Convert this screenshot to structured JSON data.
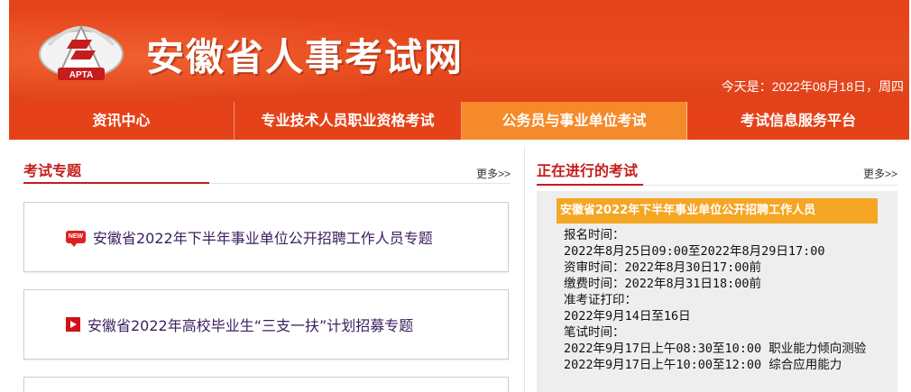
{
  "header": {
    "site_title": "安徽省人事考试网",
    "logo_text": "APTA",
    "date_text": "今天是：2022年08月18日，周四"
  },
  "nav": {
    "items": [
      {
        "label": "资讯中心",
        "active": false
      },
      {
        "label": "专业技术人员职业资格考试",
        "active": false
      },
      {
        "label": "公务员与事业单位考试",
        "active": true
      },
      {
        "label": "考试信息服务平台",
        "active": false
      }
    ]
  },
  "left": {
    "title": "考试专题",
    "more": "更多>>",
    "topics": [
      {
        "label": "安徽省2022年下半年事业单位公开招聘工作人员专题",
        "icon": "new-badge-icon",
        "icon_text": "NEW"
      },
      {
        "label": "安徽省2022年高校毕业生“三支一扶”计划招募专题",
        "icon": "play-icon"
      }
    ]
  },
  "right": {
    "title": "正在进行的考试",
    "more": "更多>>",
    "exam": {
      "title": "安徽省2022年下半年事业单位公开招聘工作人员",
      "lines": [
        "报名时间：",
        "2022年8月25日09:00至2022年8月29日17:00",
        "资审时间：2022年8月30日17:00前",
        "缴费时间：2022年8月31日18:00前",
        "准考证打印：",
        "2022年9月14日至16日",
        "笔试时间：",
        "2022年9月17日上午08:30至10:00 职业能力倾向测验",
        "2022年9月17日上午10:00至12:00 综合应用能力"
      ]
    }
  },
  "colors": {
    "brand_orange_red": "#e6421a",
    "nav_active": "#f58a2a",
    "section_red": "#c51c1c",
    "exam_title_bg": "#f5a623"
  }
}
